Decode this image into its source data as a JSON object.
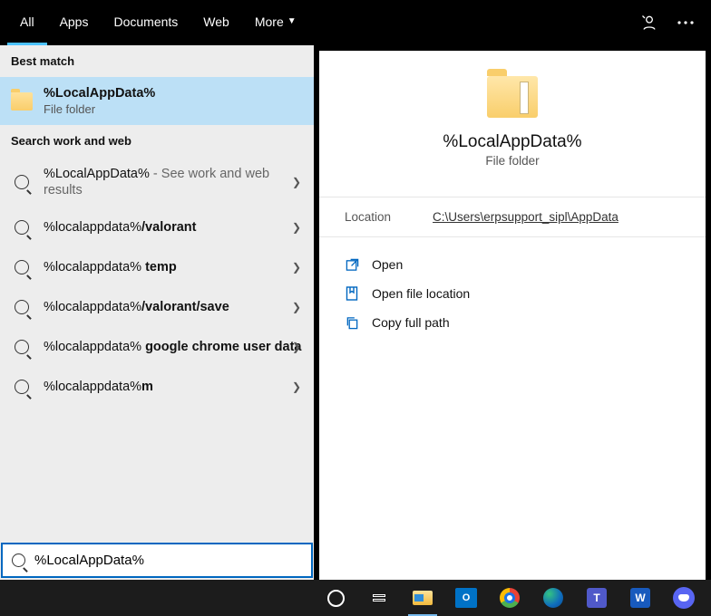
{
  "topbar": {
    "tabs": [
      {
        "label": "All",
        "active": true
      },
      {
        "label": "Apps"
      },
      {
        "label": "Documents"
      },
      {
        "label": "Web"
      },
      {
        "label": "More",
        "caret": true
      }
    ]
  },
  "left": {
    "best_match_label": "Best match",
    "best_match": {
      "title": "%LocalAppData%",
      "subtitle": "File folder"
    },
    "search_web_label": "Search work and web",
    "suggestions": [
      {
        "prefix": "%LocalAppData%",
        "bold": "",
        "desc": " - See work and web results"
      },
      {
        "prefix": "%localappdata%",
        "bold": "/valorant",
        "desc": ""
      },
      {
        "prefix": "%localappdata% ",
        "bold": "temp",
        "desc": ""
      },
      {
        "prefix": "%localappdata%",
        "bold": "/valorant/save",
        "desc": ""
      },
      {
        "prefix": "%localappdata% ",
        "bold": "google chrome user data",
        "desc": ""
      },
      {
        "prefix": "%localappdata%",
        "bold": "m",
        "desc": ""
      }
    ]
  },
  "preview": {
    "title": "%LocalAppData%",
    "subtitle": "File folder",
    "location_label": "Location",
    "location_value": "C:\\Users\\erpsupport_sipl\\AppData",
    "actions": [
      {
        "icon": "open-icon",
        "label": "Open"
      },
      {
        "icon": "open-location-icon",
        "label": "Open file location"
      },
      {
        "icon": "copy-path-icon",
        "label": "Copy full path"
      }
    ]
  },
  "search": {
    "value": "%LocalAppData%"
  },
  "taskbar": {
    "active_index": 2
  }
}
